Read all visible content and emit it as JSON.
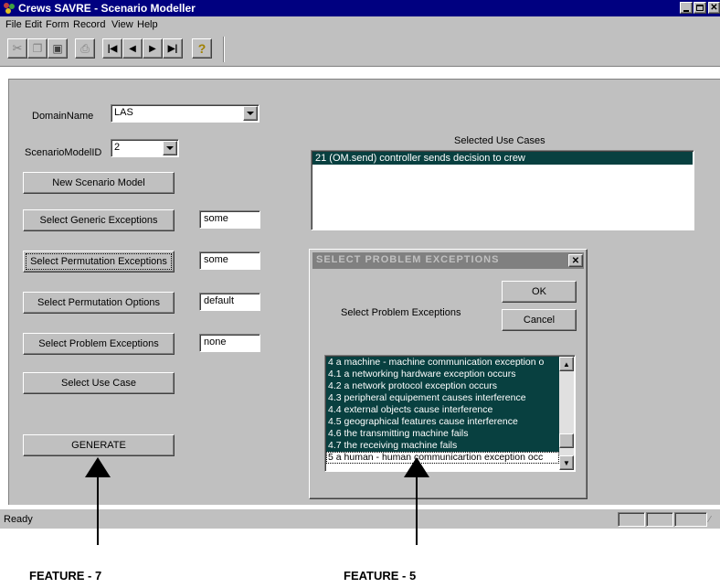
{
  "window": {
    "title": "Crews SAVRE - Scenario Modeller"
  },
  "menu": [
    "File",
    "Edit",
    "Form",
    "Record",
    "View",
    "Help"
  ],
  "form": {
    "domain_label": "DomainName",
    "domain_value": "LAS",
    "scenario_label": "ScenarioModelID",
    "scenario_value": "2",
    "buttons": {
      "new_scenario": "New Scenario Model",
      "generic_exceptions": "Select Generic Exceptions",
      "permutation_exceptions": "Select Permutation Exceptions",
      "permutation_options": "Select Permutation Options",
      "problem_exceptions": "Select Problem Exceptions",
      "use_case": "Select Use Case",
      "generate": "GENERATE"
    },
    "values": {
      "generic_exceptions": "some",
      "permutation_exceptions": "some",
      "permutation_options": "default",
      "problem_exceptions": "none"
    },
    "selected_use_cases_label": "Selected Use Cases",
    "selected_use_cases": [
      "21 (OM.send) controller sends decision to crew"
    ]
  },
  "dialog": {
    "title": "SELECT PROBLEM EXCEPTIONS",
    "label": "Select Problem Exceptions",
    "ok": "OK",
    "cancel": "Cancel",
    "items": [
      "4 a machine - machine communication exception o",
      "4.1 a networking hardware exception occurs",
      "4.2 a network protocol exception occurs",
      "4.3 peripheral equipement causes interference",
      "4.4 external objects cause interference",
      "4.5 geographical features cause interference",
      "4.6 the transmitting machine fails",
      "4.7 the receiving machine fails",
      "5 a human - human communicartion exception occ"
    ]
  },
  "status": {
    "text": "Ready"
  },
  "annotations": {
    "left": "FEATURE - 7",
    "right": "FEATURE - 5"
  },
  "colors": {
    "titlebar": "#000080",
    "highlight": "#084040",
    "dialog_title": "#808080",
    "face": "#c0c0c0"
  }
}
